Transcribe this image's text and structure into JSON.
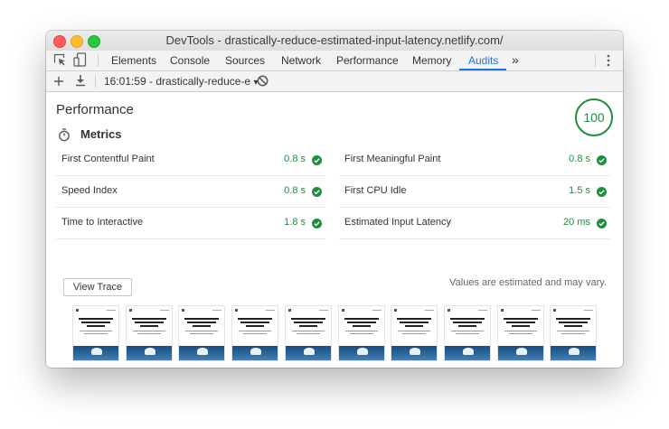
{
  "window": {
    "title": "DevTools - drastically-reduce-estimated-input-latency.netlify.com/"
  },
  "tabs": [
    {
      "label": "Elements"
    },
    {
      "label": "Console"
    },
    {
      "label": "Sources"
    },
    {
      "label": "Network"
    },
    {
      "label": "Performance"
    },
    {
      "label": "Memory"
    },
    {
      "label": "Audits",
      "active": true
    }
  ],
  "toolbar": {
    "overflow_glyph": "»",
    "report_label": "16:01:59 - drastically-reduce-e",
    "dropdown_glyph": "▾"
  },
  "report": {
    "category_title": "Performance",
    "score": "100",
    "metrics_title": "Metrics",
    "metrics": [
      {
        "label": "First Contentful Paint",
        "value": "0.8 s"
      },
      {
        "label": "First Meaningful Paint",
        "value": "0.8 s"
      },
      {
        "label": "Speed Index",
        "value": "0.8 s"
      },
      {
        "label": "First CPU Idle",
        "value": "1.5 s"
      },
      {
        "label": "Time to Interactive",
        "value": "1.8 s"
      },
      {
        "label": "Estimated Input Latency",
        "value": "20 ms"
      }
    ],
    "view_trace_label": "View Trace",
    "estimate_note": "Values are estimated and may vary.",
    "filmstrip_count": 10
  },
  "colors": {
    "pass": "#1e8e3e",
    "accent": "#1a73e8",
    "close": "#ff5f57",
    "minimize": "#febc2e",
    "zoom": "#28c840"
  },
  "icons": [
    "inspect-icon",
    "device-toolbar-icon",
    "overflow-icon",
    "kebab-menu-icon",
    "add-icon",
    "download-icon",
    "clear-icon",
    "stopwatch-icon",
    "check-circle-icon"
  ]
}
